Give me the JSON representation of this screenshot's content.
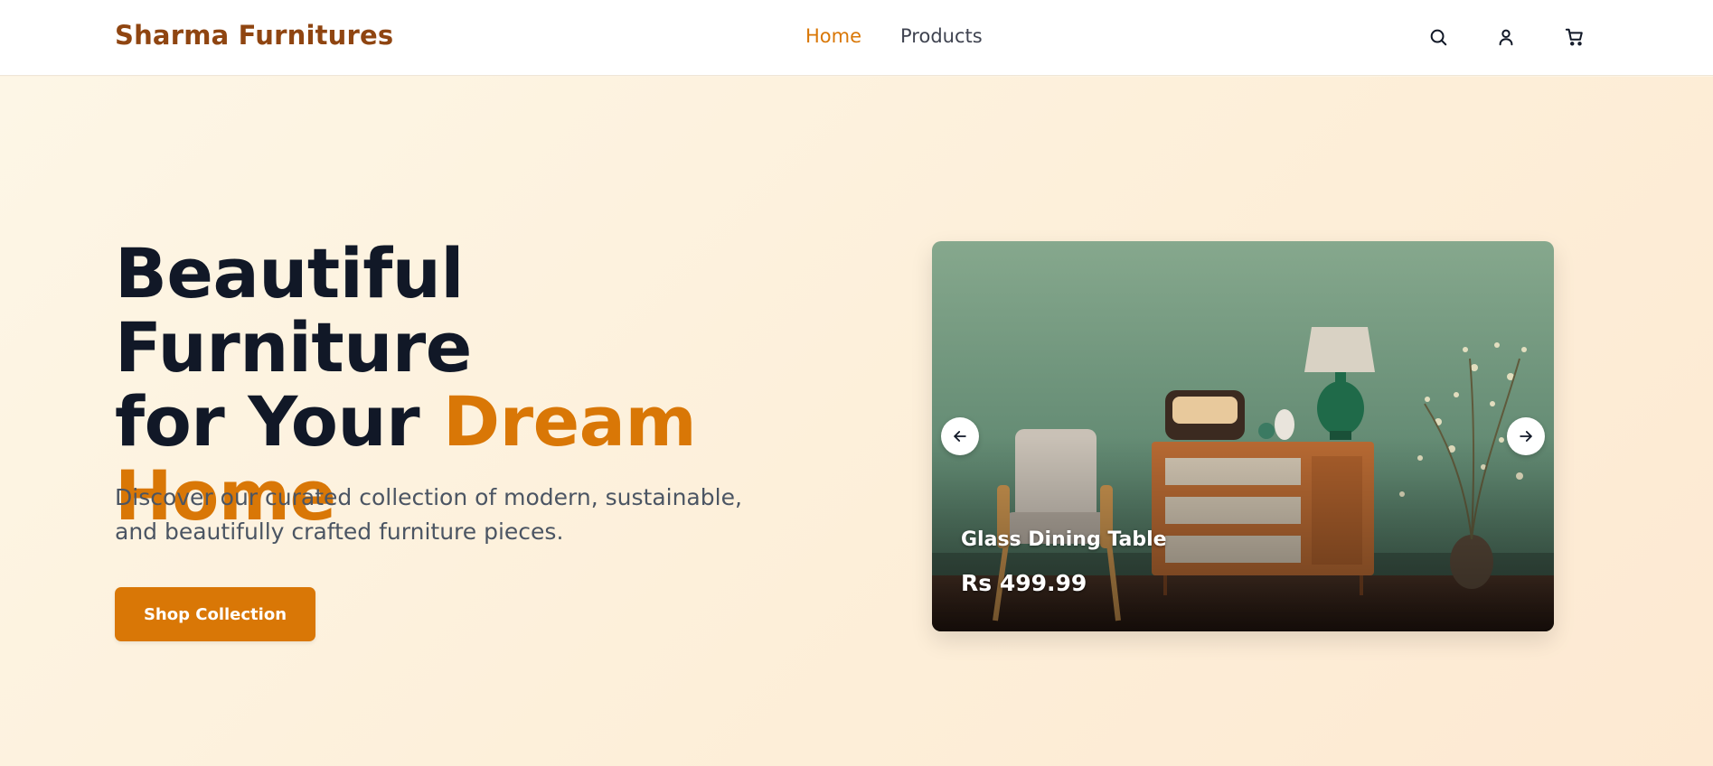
{
  "header": {
    "brand": "Sharma Furnitures",
    "nav": [
      {
        "label": "Home",
        "active": true
      },
      {
        "label": "Products",
        "active": false
      }
    ],
    "icons": [
      "search-icon",
      "user-icon",
      "cart-icon"
    ]
  },
  "hero": {
    "headline_line1": "Beautiful Furniture",
    "headline_line2_start": "for Your",
    "headline_accent_1": "Dream",
    "headline_accent_2": "Home",
    "subtext": "Discover our curated collection of modern, sustainable, and beautifully crafted furniture pieces.",
    "cta_label": "Shop Collection"
  },
  "carousel": {
    "slide_title": "Glass Dining Table",
    "slide_price": "Rs 499.99",
    "prev_icon": "arrow-left-icon",
    "next_icon": "arrow-right-icon"
  },
  "colors": {
    "brand": "#8f4511",
    "accent": "#d97706",
    "heading": "#111827",
    "body_text": "#4b5563",
    "hero_bg": "#fdf3e2"
  }
}
